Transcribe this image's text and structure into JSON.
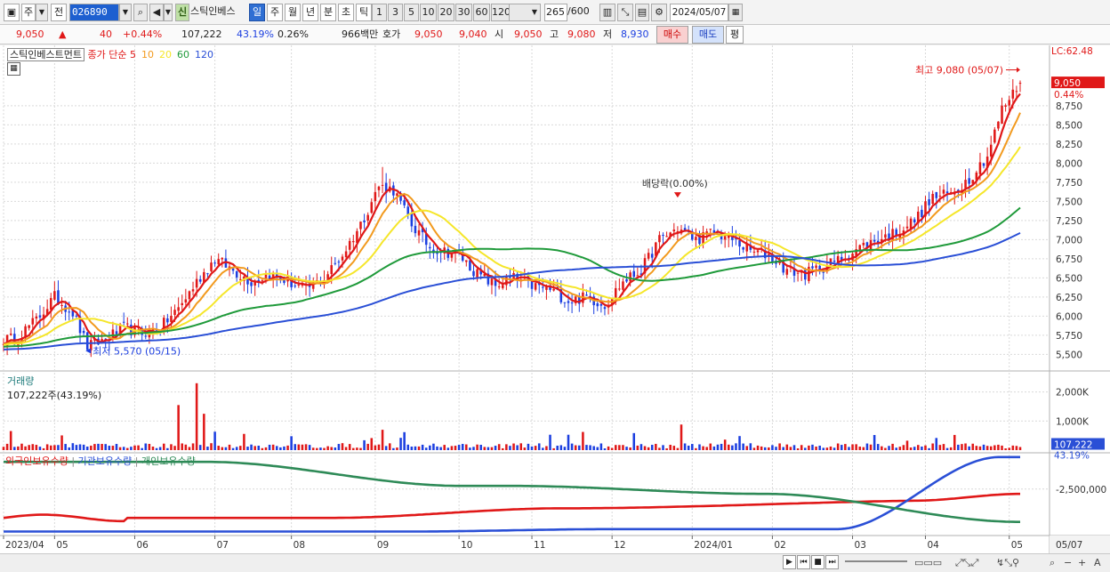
{
  "toolbar": {
    "market": "주",
    "prefix": "전",
    "code": "026890",
    "tag": "신",
    "name": "스틱인베스",
    "periods": [
      "일",
      "주",
      "월",
      "년",
      "분",
      "초",
      "틱"
    ],
    "active_period": "일",
    "intervals": [
      "1",
      "3",
      "5",
      "10",
      "20",
      "30",
      "60",
      "120"
    ],
    "count": "265",
    "count_max": "/600",
    "date": "2024/05/07"
  },
  "quote": {
    "price": "9,050",
    "arrow": "▲",
    "change": "40",
    "change_pct": "+0.44%",
    "volume": "107,222",
    "vol_ratio": "43.19%",
    "turnover": "0.26%",
    "amount": "966백만",
    "hoga_label": "호가",
    "ask": "9,050",
    "bid": "9,040",
    "open_label": "시",
    "open": "9,050",
    "high_label": "고",
    "high": "9,080",
    "low_label": "저",
    "low": "8,930",
    "buy_label": "매수",
    "sell_label": "매도",
    "eval_label": "평"
  },
  "colors": {
    "up": "#e01818",
    "down": "#1c3fe0",
    "ma5": "#e01818",
    "ma10": "#f29a1e",
    "ma20": "#f5e62a",
    "ma60": "#1f9a3a",
    "ma120": "#2a4fd6",
    "foreign": "#e01818",
    "institution": "#2a4fd6",
    "individual": "#2e8a57"
  },
  "chart_data": [
    {
      "type": "candlestick",
      "title": "스틱인베스트먼트",
      "legend_prefix": "종가 단순",
      "ma_periods": [
        "5",
        "10",
        "20",
        "60",
        "120"
      ],
      "lc_label": "LC:62.48",
      "last_price_label": "9,050",
      "last_change_label": "0.44%",
      "ylim": [
        5400,
        9400
      ],
      "yticks": [
        "8,750",
        "8,500",
        "8,250",
        "8,000",
        "7,750",
        "7,500",
        "7,250",
        "7,000",
        "6,750",
        "6,500",
        "6,250",
        "6,000",
        "5,750",
        "5,500"
      ],
      "xticks": [
        "2023/04",
        "05",
        "06",
        "07",
        "08",
        "09",
        "10",
        "11",
        "12",
        "2024/01",
        "02",
        "03",
        "04",
        "05"
      ],
      "x_end_label": "05/07",
      "annotations": [
        {
          "text": "최고 9,080 (05/07)",
          "date": "2024/05/07",
          "value": 9080
        },
        {
          "text": "최저 5,570 (05/15)",
          "date": "2023/05/15",
          "value": 5570
        },
        {
          "text": "배당락(0.00%)",
          "date": "2023/12/27",
          "value": 7300
        }
      ],
      "close_anchors": [
        [
          "2023/04/17",
          5700
        ],
        [
          "2023/04/25",
          5950
        ],
        [
          "2023/05/02",
          6250
        ],
        [
          "2023/05/09",
          6050
        ],
        [
          "2023/05/15",
          5600
        ],
        [
          "2023/05/22",
          5700
        ],
        [
          "2023/05/29",
          5850
        ],
        [
          "2023/06/05",
          5780
        ],
        [
          "2023/06/12",
          5850
        ],
        [
          "2023/06/19",
          6100
        ],
        [
          "2023/06/26",
          6450
        ],
        [
          "2023/07/03",
          6750
        ],
        [
          "2023/07/10",
          6600
        ],
        [
          "2023/07/17",
          6450
        ],
        [
          "2023/07/24",
          6550
        ],
        [
          "2023/07/31",
          6450
        ],
        [
          "2023/08/07",
          6350
        ],
        [
          "2023/08/14",
          6500
        ],
        [
          "2023/08/21",
          6800
        ],
        [
          "2023/08/28",
          7200
        ],
        [
          "2023/09/04",
          7700
        ],
        [
          "2023/09/08",
          7650
        ],
        [
          "2023/09/15",
          7200
        ],
        [
          "2023/09/22",
          6900
        ],
        [
          "2023/10/04",
          6800
        ],
        [
          "2023/10/11",
          6550
        ],
        [
          "2023/10/18",
          6400
        ],
        [
          "2023/10/25",
          6500
        ],
        [
          "2023/11/01",
          6400
        ],
        [
          "2023/11/08",
          6350
        ],
        [
          "2023/11/15",
          6200
        ],
        [
          "2023/11/22",
          6250
        ],
        [
          "2023/11/29",
          6150
        ],
        [
          "2023/12/06",
          6450
        ],
        [
          "2023/12/13",
          6600
        ],
        [
          "2023/12/20",
          7000
        ],
        [
          "2023/12/27",
          7150
        ],
        [
          "2024/01/03",
          7000
        ],
        [
          "2024/01/10",
          7100
        ],
        [
          "2024/01/17",
          7000
        ],
        [
          "2024/01/24",
          6850
        ],
        [
          "2024/01/31",
          6800
        ],
        [
          "2024/02/07",
          6600
        ],
        [
          "2024/02/14",
          6550
        ],
        [
          "2024/02/21",
          6650
        ],
        [
          "2024/02/28",
          6750
        ],
        [
          "2024/03/06",
          6900
        ],
        [
          "2024/03/13",
          7000
        ],
        [
          "2024/03/20",
          7100
        ],
        [
          "2024/03/27",
          7250
        ],
        [
          "2024/04/03",
          7550
        ],
        [
          "2024/04/10",
          7600
        ],
        [
          "2024/04/17",
          7800
        ],
        [
          "2024/04/24",
          8100
        ],
        [
          "2024/04/30",
          8700
        ],
        [
          "2024/05/07",
          9050
        ]
      ]
    },
    {
      "type": "bar",
      "title": "거래량",
      "current_label": "107,222주(43.19%)",
      "last_label": "107,222",
      "last_pct_label": "43.19%",
      "yticks": [
        "2,000K",
        "1,000K"
      ],
      "ylim": [
        0,
        2600000
      ],
      "spikes": [
        [
          "2023/06/19",
          1550000
        ],
        [
          "2023/06/26",
          2300000
        ],
        [
          "2023/06/28",
          1250000
        ],
        [
          "2023/09/05",
          700000
        ],
        [
          "2023/12/28",
          880000
        ]
      ]
    },
    {
      "type": "line",
      "series_names": [
        "외국인보유수량",
        "기관보유수량",
        "개인보유수량"
      ],
      "yticks": [
        "-2,500,000"
      ]
    }
  ]
}
